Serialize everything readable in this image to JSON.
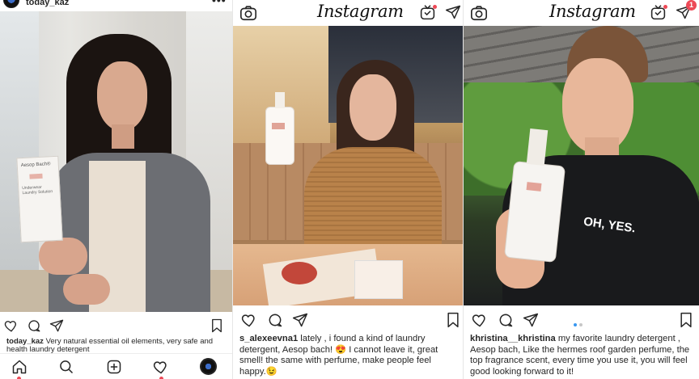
{
  "panels": [
    {
      "username": "today_kaz",
      "more": "•••",
      "caption_user": "today_kaz",
      "caption_text": "Very natural essential oil elements, very safe and health laundry detergent",
      "product_label": "Aesop Bach®",
      "product_sub": "Underwear Laundry Solution"
    },
    {
      "logo": "Instagram",
      "caption_user": "s_alexeevna1",
      "caption_text": "lately , i found a kind of laundry detergent, Aesop bach! 😍 I cannot leave it, great smell! the same with perfume, make people feel happy.😉"
    },
    {
      "logo": "Instagram",
      "notification_count": "1",
      "caption_user": "khristina__khristina",
      "caption_text": "my favorite laundry detergent , Aesop bach, Like the hermes roof garden perfume, the top fragrance scent, every time you use it, you will feel good looking forward to it!",
      "hoodie_text": "OH, YES."
    }
  ],
  "icons": [
    "camera-icon",
    "igtv-icon",
    "direct-message-icon",
    "heart-icon",
    "comment-icon",
    "share-icon",
    "bookmark-icon",
    "home-icon",
    "search-icon",
    "add-post-icon",
    "activity-icon",
    "profile-avatar-icon",
    "more-options-icon"
  ],
  "colors": {
    "accent_blue": "#3897f0",
    "notification_red": "#ed4956",
    "text": "#262626"
  }
}
